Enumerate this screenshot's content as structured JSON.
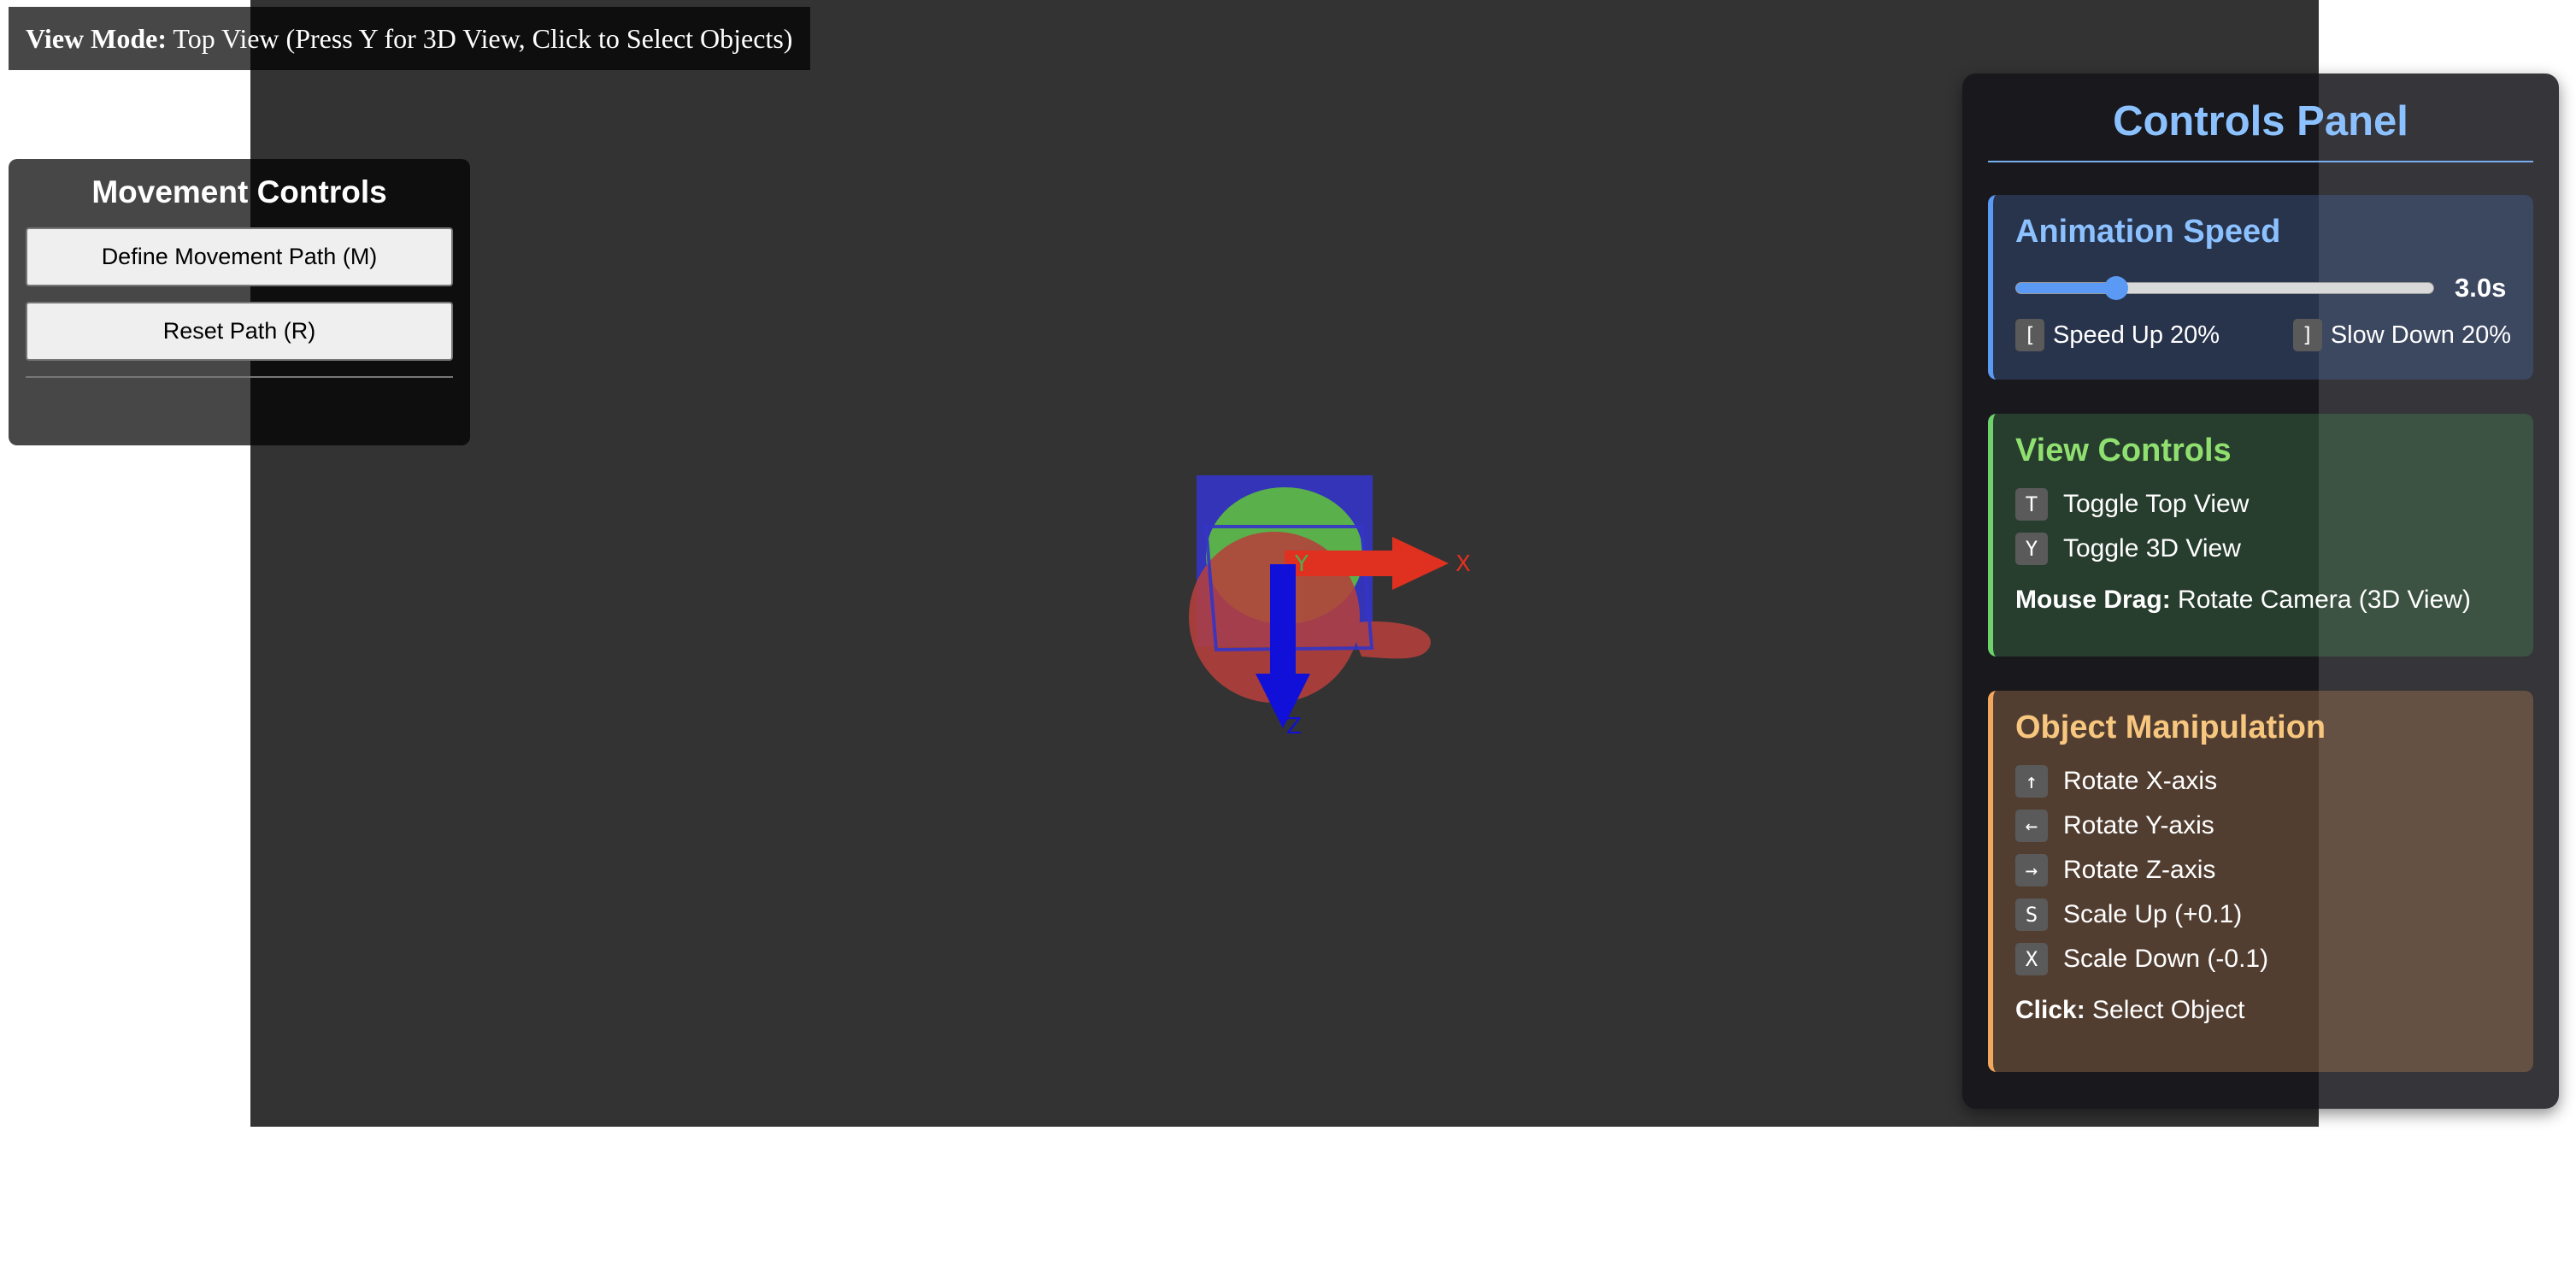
{
  "viewmode": {
    "label": "View Mode:",
    "text": "Top View (Press Y for 3D View, Click to Select Objects)"
  },
  "movement": {
    "title": "Movement Controls",
    "define_label": "Define Movement Path (M)",
    "reset_label": "Reset Path (R)"
  },
  "scene": {
    "axis_x": "X",
    "axis_y": "Y",
    "axis_z": "Z"
  },
  "panel": {
    "title": "Controls Panel",
    "speed": {
      "title": "Animation Speed",
      "value_label": "3.0s",
      "slider_fraction": 0.24,
      "speed_up_key": "[",
      "speed_up_label": "Speed Up 20%",
      "slow_down_key": "]",
      "slow_down_label": "Slow Down 20%"
    },
    "view": {
      "title": "View Controls",
      "items": [
        {
          "key": "T",
          "label": "Toggle Top View"
        },
        {
          "key": "Y",
          "label": "Toggle 3D View"
        }
      ],
      "note_bold": "Mouse Drag:",
      "note_text": " Rotate Camera (3D View)"
    },
    "object": {
      "title": "Object Manipulation",
      "items": [
        {
          "key": "↑",
          "label": "Rotate X-axis"
        },
        {
          "key": "←",
          "label": "Rotate Y-axis"
        },
        {
          "key": "→",
          "label": "Rotate Z-axis"
        },
        {
          "key": "S",
          "label": "Scale Up (+0.1)"
        },
        {
          "key": "X",
          "label": "Scale Down (-0.1)"
        }
      ],
      "note_bold": "Click:",
      "note_text": " Select Object"
    }
  },
  "colors": {
    "viewport_bg": "#333333",
    "axis_x": "#e03020",
    "axis_y": "#4caf50",
    "axis_z": "#1010d8",
    "object_red": "#b5403c",
    "object_green": "#5ab04a",
    "object_blue": "#3434c8"
  }
}
